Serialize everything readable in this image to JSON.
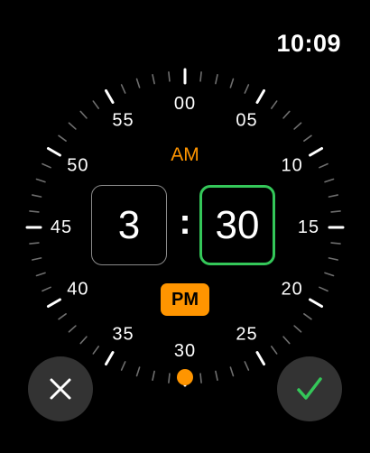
{
  "status_bar": {
    "time": "10:09"
  },
  "dial": {
    "minute_labels": [
      "00",
      "05",
      "10",
      "15",
      "20",
      "25",
      "30",
      "35",
      "40",
      "45",
      "50",
      "55"
    ],
    "selected_minute": 30,
    "indicator_color": "#ff9500"
  },
  "picker": {
    "hour": "3",
    "separator": ":",
    "minute": "30",
    "active_field": "minute",
    "am_label": "AM",
    "pm_label": "PM",
    "selected_period": "PM"
  },
  "buttons": {
    "cancel_icon": "close-icon",
    "confirm_icon": "checkmark-icon"
  },
  "colors": {
    "accent_orange": "#ff9500",
    "active_green": "#34c759",
    "button_bg": "#333333"
  }
}
